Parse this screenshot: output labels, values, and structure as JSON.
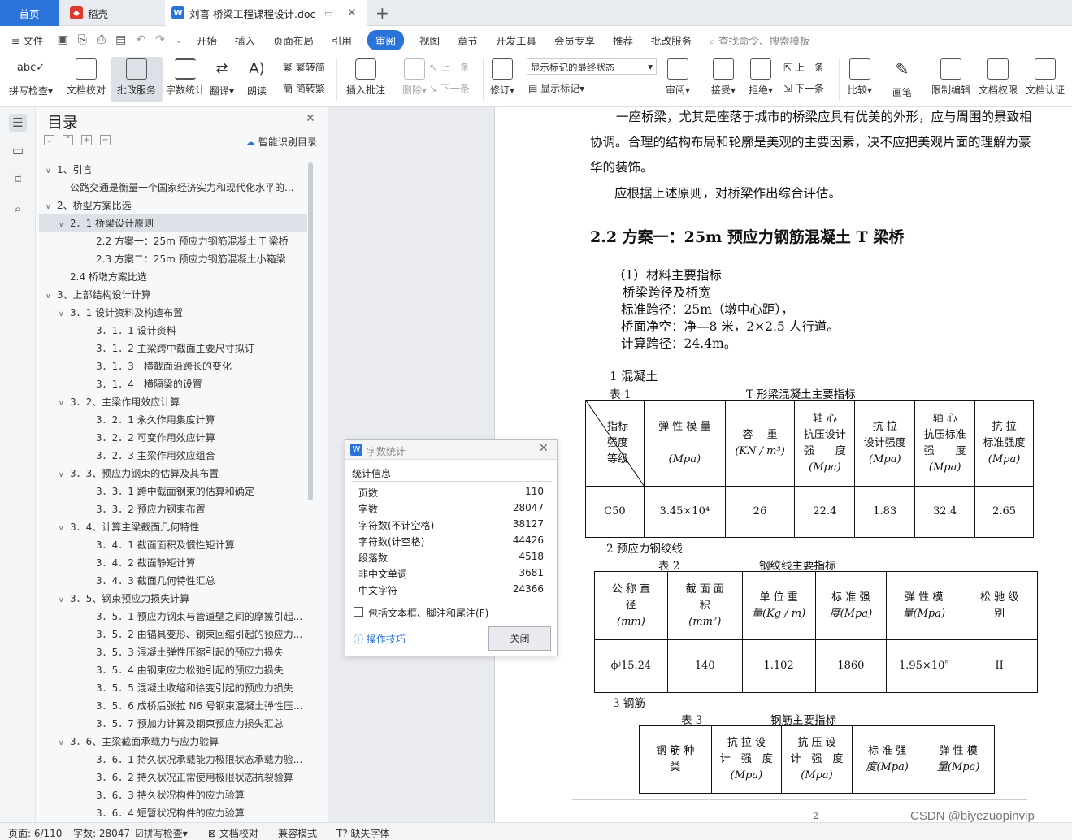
{
  "tabs": {
    "home": "首页",
    "daoke": "稻壳",
    "doc": "刘喜 桥梁工程课程设计.doc"
  },
  "menubar": {
    "file": "文件",
    "items": [
      "开始",
      "插入",
      "页面布局",
      "引用",
      "审阅",
      "视图",
      "章节",
      "开发工具",
      "会员专享",
      "推荐",
      "批改服务"
    ],
    "active": "审阅",
    "search_placeholder": "查找命令、搜索模板"
  },
  "ribbon": {
    "spellcheck": "拼写检查",
    "doc_check": "文档校对",
    "correct_service": "批改服务",
    "word_count": "字数统计",
    "translate": "翻译",
    "read_aloud": "朗读",
    "trad_to_simp": "繁转简",
    "simp_to_trad": "简转繁",
    "insert_comment": "插入批注",
    "delete": "删除",
    "prev_comment": "上一条",
    "next_comment": "下一条",
    "revise": "修订",
    "markup_mode": "显示标记的最终状态",
    "show_markup": "显示标记",
    "review": "审阅",
    "accept": "接受",
    "reject": "拒绝",
    "prev": "上一条",
    "next": "下一条",
    "compare": "比较",
    "pen": "画笔",
    "restrict_edit": "限制编辑",
    "doc_permission": "文档权限",
    "doc_certify": "文档认证"
  },
  "toc": {
    "title": "目录",
    "smart": "智能识别目录",
    "items": [
      {
        "label": "1、引言",
        "level": 0,
        "arrow": "v"
      },
      {
        "label": "公路交通是衡量一个国家经济实力和现代化水平的...",
        "level": 1,
        "arrow": ""
      },
      {
        "label": "2、桥型方案比选",
        "level": 0,
        "arrow": "v"
      },
      {
        "label": "2．1 桥梁设计原则",
        "level": 1,
        "arrow": "v",
        "selected": true
      },
      {
        "label": "2.2 方案一：25m 预应力钢筋混凝土 T 梁桥",
        "level": 2,
        "arrow": ""
      },
      {
        "label": "2.3 方案二：25m 预应力钢筋混凝土小箱梁",
        "level": 2,
        "arrow": ""
      },
      {
        "label": "2.4 桥墩方案比选",
        "level": 1,
        "arrow": ""
      },
      {
        "label": "3、上部结构设计计算",
        "level": 0,
        "arrow": "v"
      },
      {
        "label": "3．1 设计资料及构造布置",
        "level": 1,
        "arrow": "v"
      },
      {
        "label": "3．1．1 设计资料",
        "level": 2,
        "arrow": ""
      },
      {
        "label": "3．1．2 主梁跨中截面主要尺寸拟订",
        "level": 2,
        "arrow": ""
      },
      {
        "label": "3．1．3　横截面沿跨长的变化",
        "level": 2,
        "arrow": ""
      },
      {
        "label": "3．1．4　横隔梁的设置",
        "level": 2,
        "arrow": ""
      },
      {
        "label": "3．2、主梁作用效应计算",
        "level": 1,
        "arrow": "v"
      },
      {
        "label": "3．2．1 永久作用集度计算",
        "level": 2,
        "arrow": ""
      },
      {
        "label": "3．2．2 可变作用效应计算",
        "level": 2,
        "arrow": ""
      },
      {
        "label": "3．2．3 主梁作用效应组合",
        "level": 2,
        "arrow": ""
      },
      {
        "label": "3．3、预应力钢束的估算及其布置",
        "level": 1,
        "arrow": "v"
      },
      {
        "label": "3．3．1 跨中截面钢束的估算和确定",
        "level": 2,
        "arrow": ""
      },
      {
        "label": "3．3．2 预应力钢束布置",
        "level": 2,
        "arrow": ""
      },
      {
        "label": "3．4、计算主梁截面几何特性",
        "level": 1,
        "arrow": "v"
      },
      {
        "label": "3．4．1 截面面积及惯性矩计算",
        "level": 2,
        "arrow": ""
      },
      {
        "label": "3．4．2 截面静矩计算",
        "level": 2,
        "arrow": ""
      },
      {
        "label": "3．4．3 截面几何特性汇总",
        "level": 2,
        "arrow": ""
      },
      {
        "label": "3．5、钢束预应力损失计算",
        "level": 1,
        "arrow": "v"
      },
      {
        "label": "3．5．1 预应力钢束与管道壁之间的摩擦引起...",
        "level": 2,
        "arrow": ""
      },
      {
        "label": "3．5．2 由锚具变形、钢束回缩引起的预应力...",
        "level": 2,
        "arrow": ""
      },
      {
        "label": "3．5．3 混凝土弹性压缩引起的预应力损失",
        "level": 2,
        "arrow": ""
      },
      {
        "label": "3．5．4 由钢束应力松弛引起的预应力损失",
        "level": 2,
        "arrow": ""
      },
      {
        "label": "3．5．5 混凝土收缩和徐变引起的预应力损失",
        "level": 2,
        "arrow": ""
      },
      {
        "label": "3．5．6 成桥后张拉 N6 号钢束混凝土弹性压...",
        "level": 2,
        "arrow": ""
      },
      {
        "label": "3．5．7 预加力计算及钢束预应力损失汇总",
        "level": 2,
        "arrow": ""
      },
      {
        "label": "3．6、主梁截面承载力与应力验算",
        "level": 1,
        "arrow": "v"
      },
      {
        "label": "3．6．1 持久状况承载能力极限状态承载力验...",
        "level": 2,
        "arrow": ""
      },
      {
        "label": "3．6．2 持久状况正常使用极限状态抗裂验算",
        "level": 2,
        "arrow": ""
      },
      {
        "label": "3．6．3 持久状况构件的应力验算",
        "level": 2,
        "arrow": ""
      },
      {
        "label": "3．6．4 短暂状况构件的应力验算",
        "level": 2,
        "arrow": ""
      }
    ]
  },
  "dialog": {
    "title": "字数统计",
    "section": "统计信息",
    "rows": [
      {
        "label": "页数",
        "value": "110"
      },
      {
        "label": "字数",
        "value": "28047"
      },
      {
        "label": "字符数(不计空格)",
        "value": "38127"
      },
      {
        "label": "字符数(计空格)",
        "value": "44426"
      },
      {
        "label": "段落数",
        "value": "4518"
      },
      {
        "label": "非中文单词",
        "value": "3681"
      },
      {
        "label": "中文字符",
        "value": "24366"
      }
    ],
    "checkbox": "包括文本框、脚注和尾注(F)",
    "tips": "操作技巧",
    "close": "关闭"
  },
  "doc": {
    "p1": "一座桥梁，尤其是座落于城市的桥梁应具有优美的外形，应与周围的景致相",
    "p2": "协调。合理的结构布局和轮廓是美观的主要因素，决不应把美观片面的理解为豪",
    "p3": "华的装饰。",
    "p4": "应根据上述原则，对桥梁作出综合评估。",
    "heading": "2.2 方案一：25m 预应力钢筋混凝土 T 梁桥",
    "s1": "（1）材料主要指标",
    "s2": "桥梁跨径及桥宽",
    "s3": "标准跨径：25m（墩中心距），",
    "s4": "桥面净空：净—8 米，2×2.5 人行道。",
    "s5": "计算跨径：24.4m。",
    "c1": "1 混凝土",
    "t1_no": "表 1",
    "t1_title": "T 形梁混凝土主要指标",
    "t1_head": [
      "指标",
      "强度",
      "等级",
      "弹 性 模 量",
      "(Mpa)",
      "容　 重",
      "(KN / m³)",
      "轴 心",
      "抗压设计",
      "强　　度",
      "(Mpa)",
      "抗 拉",
      "设计强度",
      "(Mpa)",
      "轴 心",
      "抗压标准",
      "强　　度",
      "(Mpa)",
      "抗 拉",
      "标准强度",
      "(Mpa)"
    ],
    "t1_row": [
      "C50",
      "3.45×10⁴",
      "26",
      "22.4",
      "1.83",
      "32.4",
      "2.65"
    ],
    "c2": "2 预应力钢绞线",
    "t2_no": "表 2",
    "t2_title": "钢绞线主要指标",
    "t2_head": [
      "公 称 直",
      "径",
      "(mm)",
      "截 面 面",
      "积",
      "(mm²)",
      "单 位 重",
      "量(Kg / m)",
      "标 准 强",
      "度(Mpa)",
      "弹 性 模",
      "量(Mpa)",
      "松 驰 级",
      "别"
    ],
    "t2_row": [
      "ϕʲ15.24",
      "140",
      "1.102",
      "1860",
      "1.95×10⁵",
      "II"
    ],
    "c3": "3 钢筋",
    "t3_no": "表 3",
    "t3_title": "钢筋主要指标",
    "t3_head": [
      "钢 筋 种",
      "类",
      "抗 拉 设",
      "计　强　度",
      "(Mpa)",
      "抗 压 设",
      "计　强　度",
      "(Mpa)",
      "标 准 强",
      "度(Mpa)",
      "弹 性 模",
      "量(Mpa)"
    ],
    "page_num": "2"
  },
  "status": {
    "page": "页面: 6/110",
    "words": "字数: 28047",
    "spell": "拼写检查",
    "check": "文档校对",
    "compat": "兼容模式",
    "font": "缺失字体"
  },
  "watermark": "CSDN @biyezuopinvip"
}
